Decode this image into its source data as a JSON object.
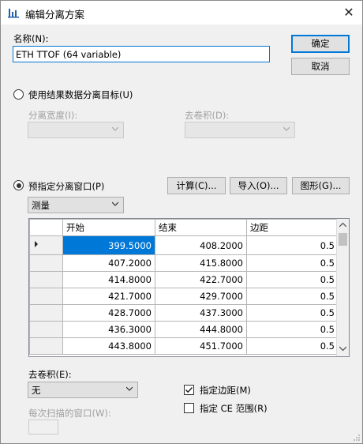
{
  "window": {
    "title": "编辑分离方案",
    "close_label": "✕"
  },
  "name_section": {
    "label": "名称(N):",
    "value": "ETH TTOF (64 variable)"
  },
  "buttons": {
    "ok": "确定",
    "cancel": "取消",
    "calculate": "计算(C)...",
    "import": "导入(O)...",
    "graph": "图形(G)..."
  },
  "option_targets": {
    "label": "使用结果数据分离目标(U)",
    "width_label": "分离宽度(I):",
    "deconv_label": "去卷积(D):"
  },
  "option_predefined": {
    "label": "预指定分离窗口(P)",
    "mode_selected": "测量"
  },
  "grid": {
    "columns": [
      "开始",
      "结束",
      "边距"
    ],
    "rows": [
      {
        "start": "399.5000",
        "end": "408.2000",
        "margin": "0.5"
      },
      {
        "start": "407.2000",
        "end": "415.8000",
        "margin": "0.5"
      },
      {
        "start": "414.8000",
        "end": "422.7000",
        "margin": "0.5"
      },
      {
        "start": "421.7000",
        "end": "429.7000",
        "margin": "0.5"
      },
      {
        "start": "428.7000",
        "end": "437.3000",
        "margin": "0.5"
      },
      {
        "start": "436.3000",
        "end": "444.8000",
        "margin": "0.5"
      },
      {
        "start": "443.8000",
        "end": "451.7000",
        "margin": "0.5"
      }
    ]
  },
  "deconvolution": {
    "label": "去卷积(E):",
    "selected": "无"
  },
  "window_per_scan": {
    "label": "每次扫描的窗口(W):",
    "value": ""
  },
  "checkboxes": {
    "specify_margin": {
      "label": "指定边距(M)",
      "checked": true
    },
    "specify_ce_range": {
      "label": "指定 CE 范围(R)",
      "checked": false
    }
  },
  "colors": {
    "selection": "#0078d7",
    "focus_border": "#0078d7"
  }
}
